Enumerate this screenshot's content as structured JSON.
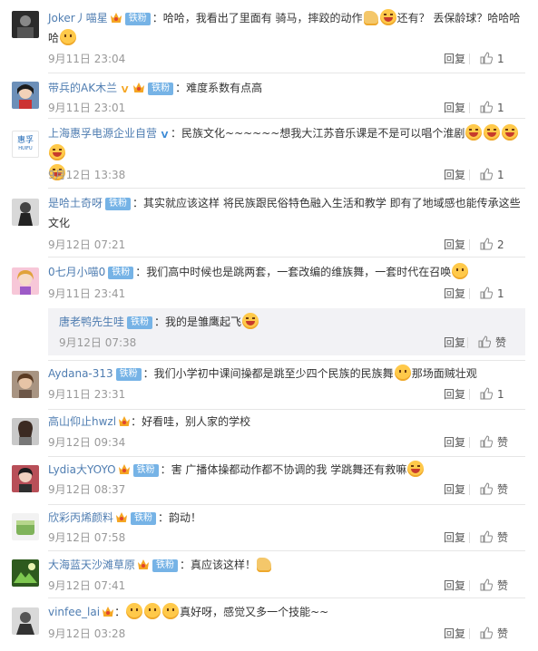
{
  "fan_badge": "铁粉",
  "reply_label": "回复",
  "like_label": "赞",
  "comments": [
    {
      "user": "Joker丿喵星",
      "text": "：哈哈，我看出了里面有 骑马，摔跤的动作",
      "text2": "还有？ 丢保龄球？哈哈哈",
      "text3": "哈",
      "time": "9月11日 23:04",
      "likes": "1"
    },
    {
      "user": "带兵的AK木兰",
      "text": "：难度系数有点高",
      "time": "9月11日 23:01",
      "likes": "1"
    },
    {
      "user": "上海惠孚电源企业自营",
      "text": "：民族文化~~~~~~想我大江苏音乐课是不是可以唱个淮剧",
      "time": "9月12日 13:38",
      "likes": "1",
      "avatar_text": "惠孚",
      "avatar_sub": "HUIFU"
    },
    {
      "user": "是哈土奇呀",
      "text": "：其实就应该这样 将民族跟民俗特色融入生活和教学 即有了地域感也能传承这些",
      "text2": "文化",
      "time": "9月12日 07:21",
      "likes": "2"
    },
    {
      "user": "0七月小喵0",
      "text": "：我们高中时候也是跳两套，一套改编的维族舞，一套时代在召唤",
      "time": "9月11日 23:41",
      "likes": "1"
    },
    {
      "user": "唐老鸭先生哇",
      "text": "：我的是雏鹰起飞",
      "time": "9月12日 07:38"
    },
    {
      "user": "Aydana-313",
      "text": "：我们小学初中课间操都是跳至少四个民族的民族舞",
      "text2": "那场面贼壮观",
      "time": "9月11日 23:31",
      "likes": "1"
    },
    {
      "user": "高山仰止hwzl",
      "text": "：好看哇，别人家的学校",
      "time": "9月12日 09:34"
    },
    {
      "user": "Lydia大YOYO",
      "text": "：害 广播体操都动作都不协调的我 学跳舞还有救嘛",
      "time": "9月12日 08:37"
    },
    {
      "user": "欣彩丙烯颜料",
      "text": "：韵动！",
      "time": "9月12日 07:58"
    },
    {
      "user": "大海蓝天沙滩草原",
      "text": "：真应该这样！",
      "time": "9月12日 07:41"
    },
    {
      "user": "vinfee_lai",
      "text": "：",
      "text2": "真好呀，感觉又多一个技能~~",
      "time": "9月12日 03:28"
    }
  ],
  "colors": {
    "username": "#4f7db1",
    "fan_badge_bg": "#76b3e6",
    "subreply_bg": "#f2f2f5",
    "meta_text": "#999999"
  },
  "icons": [
    "crown-icon",
    "verified-icon",
    "thumb-up-icon",
    "laugh-emoji-icon",
    "cute-emoji-icon",
    "thumbs-emoji-icon"
  ]
}
